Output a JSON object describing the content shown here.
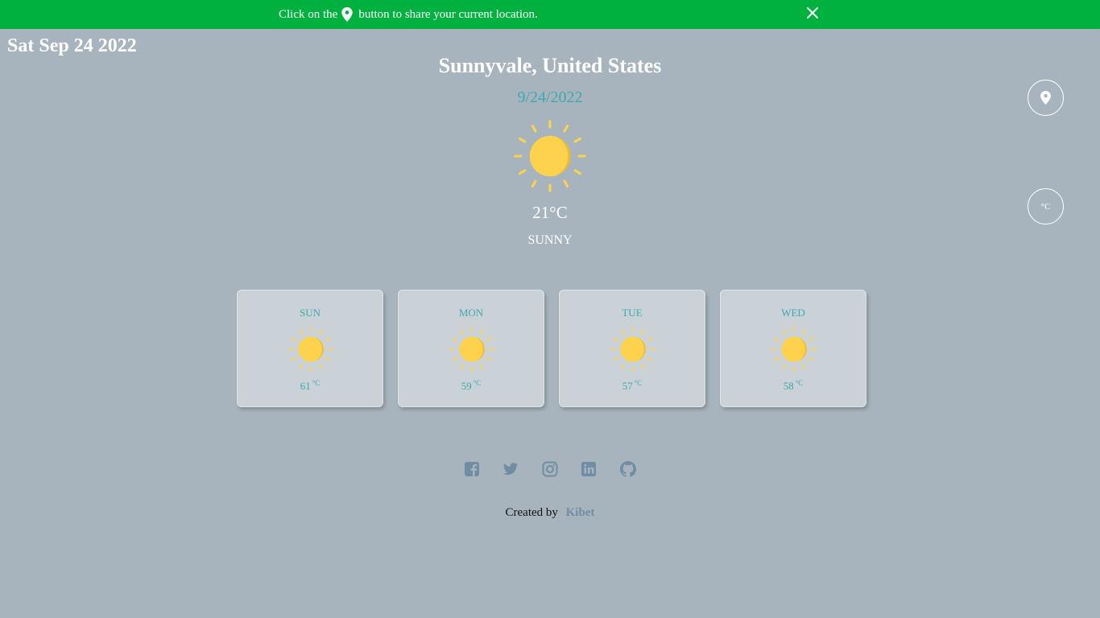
{
  "banner": {
    "text_before": "Click on the",
    "text_after": "button to share your current location.",
    "pin_icon": "location-pin-icon",
    "close_icon": "close-icon"
  },
  "header": {
    "date_long": "Sat Sep 24 2022"
  },
  "current": {
    "location": "Sunnyvale, United States",
    "date": "9/24/2022",
    "icon": "sun-icon",
    "temperature": "21°C",
    "condition": "SUNNY"
  },
  "controls": {
    "location_button_icon": "location-pin-icon",
    "unit_label": "°C"
  },
  "forecast": [
    {
      "day": "SUN",
      "temp": "61",
      "unit": "°C",
      "icon": "sun-icon"
    },
    {
      "day": "MON",
      "temp": "59",
      "unit": "°C",
      "icon": "sun-icon"
    },
    {
      "day": "TUE",
      "temp": "57",
      "unit": "°C",
      "icon": "sun-icon"
    },
    {
      "day": "WED",
      "temp": "58",
      "unit": "°C",
      "icon": "sun-icon"
    }
  ],
  "social": [
    "facebook-icon",
    "twitter-icon",
    "instagram-icon",
    "linkedin-icon",
    "github-icon"
  ],
  "footer": {
    "created_by": "Created by",
    "author": "Kibet"
  },
  "colors": {
    "background": "#a8b4bd",
    "banner": "#00b140",
    "accent": "#3fa9ae",
    "sun": "#ffd24d",
    "icon_muted": "#6f8ea3"
  }
}
